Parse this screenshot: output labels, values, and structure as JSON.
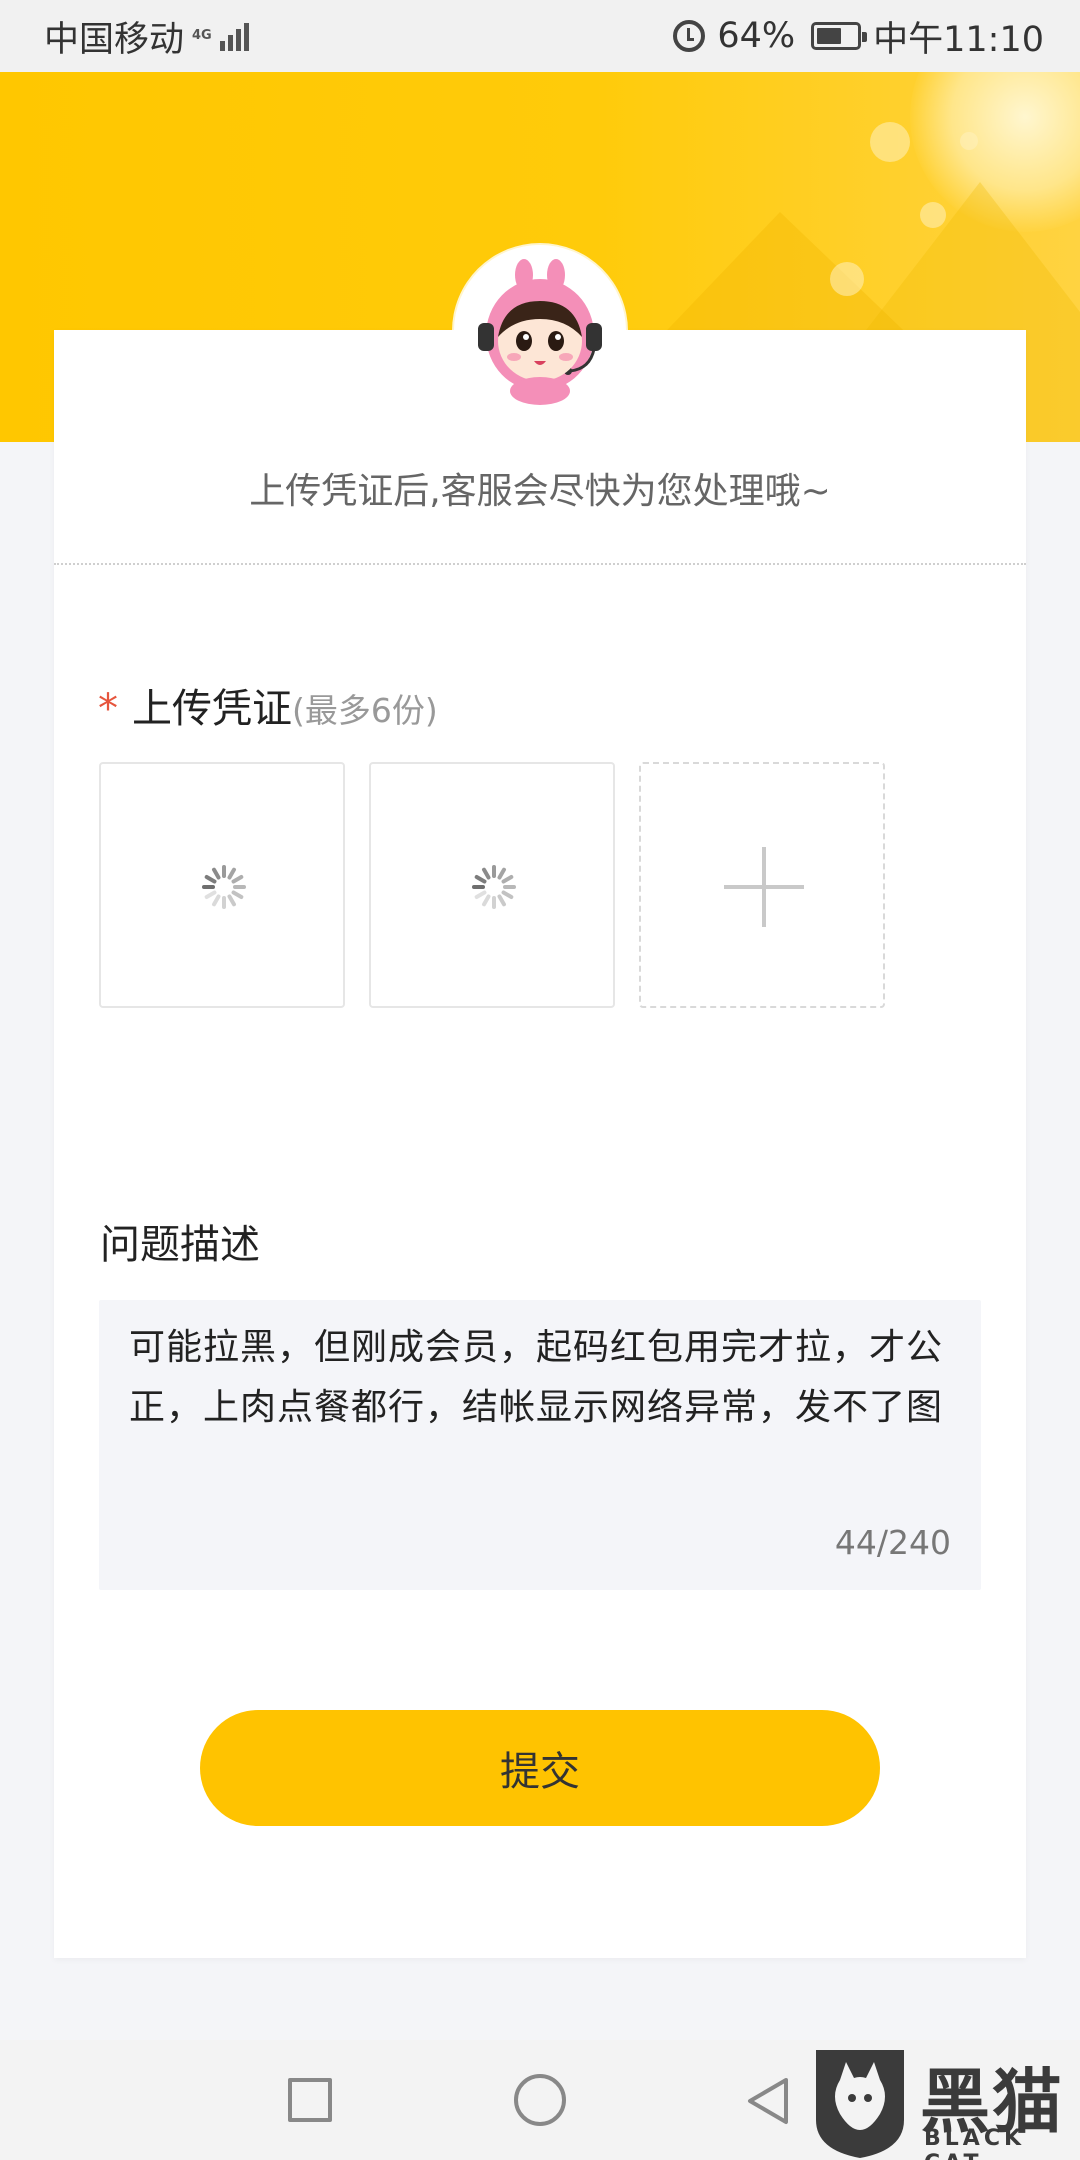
{
  "status_bar": {
    "carrier": "中国移动",
    "network_type": "4G",
    "battery_percent": "64%",
    "time": "中午11:10"
  },
  "header": {
    "avatar": "customer-service-mascot",
    "tagline": "上传凭证后,客服会尽快为您处理哦~"
  },
  "upload": {
    "required_mark": "*",
    "label": "上传凭证",
    "hint": "(最多6份)",
    "slots": [
      {
        "state": "loading"
      },
      {
        "state": "loading"
      },
      {
        "state": "add"
      }
    ]
  },
  "description": {
    "label": "问题描述",
    "value": "可能拉黑，但刚成会员，起码红包用完才拉，才公正，上肉点餐都行，结帐显示网络异常，发不了图",
    "counter": "44/240"
  },
  "submit": {
    "label": "提交"
  },
  "nav_bar": {
    "buttons": [
      "recent-apps",
      "home",
      "back"
    ]
  },
  "watermark": {
    "cn": "黑猫",
    "en": "BLACK CAT"
  },
  "colors": {
    "accent": "#ffc300",
    "header_yellow": "#ffc700",
    "required": "#e6553d"
  }
}
